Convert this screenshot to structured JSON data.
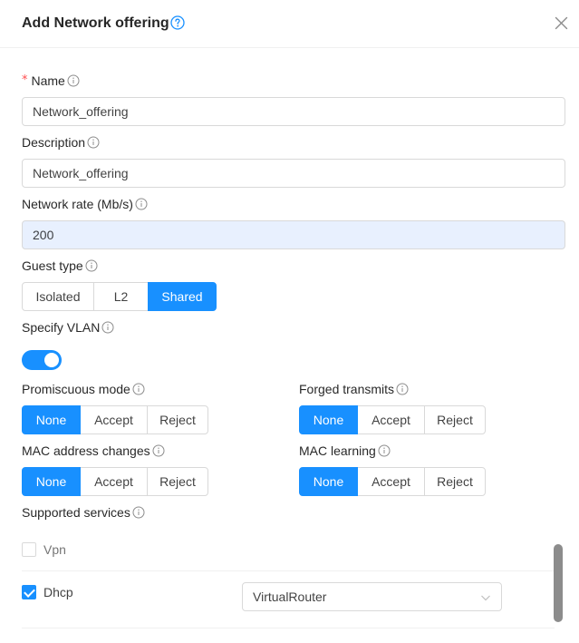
{
  "dialog": {
    "title": "Add Network offering"
  },
  "form": {
    "name": {
      "label": "Name",
      "value": "Network_offering"
    },
    "description": {
      "label": "Description",
      "value": "Network_offering"
    },
    "network_rate": {
      "label": "Network rate (Mb/s)",
      "value": "200"
    },
    "guest_type": {
      "label": "Guest type",
      "options": [
        "Isolated",
        "L2",
        "Shared"
      ],
      "selected": "Shared"
    },
    "specify_vlan": {
      "label": "Specify VLAN",
      "enabled": true
    },
    "promiscuous_mode": {
      "label": "Promiscuous mode",
      "options": [
        "None",
        "Accept",
        "Reject"
      ],
      "selected": "None"
    },
    "forged_transmits": {
      "label": "Forged transmits",
      "options": [
        "None",
        "Accept",
        "Reject"
      ],
      "selected": "None"
    },
    "mac_address_changes": {
      "label": "MAC address changes",
      "options": [
        "None",
        "Accept",
        "Reject"
      ],
      "selected": "None"
    },
    "mac_learning": {
      "label": "MAC learning",
      "options": [
        "None",
        "Accept",
        "Reject"
      ],
      "selected": "None"
    },
    "supported_services": {
      "label": "Supported services",
      "items": [
        {
          "name": "Vpn",
          "checked": false
        },
        {
          "name": "Dhcp",
          "checked": true,
          "provider": "VirtualRouter"
        }
      ]
    }
  },
  "colors": {
    "primary": "#1890ff",
    "required": "#ff4d4f",
    "autofill": "#e8f0fe"
  },
  "icons": {
    "help": "question-circle-icon",
    "info": "info-circle-icon",
    "close": "close-icon",
    "chevron": "chevron-down-icon"
  }
}
